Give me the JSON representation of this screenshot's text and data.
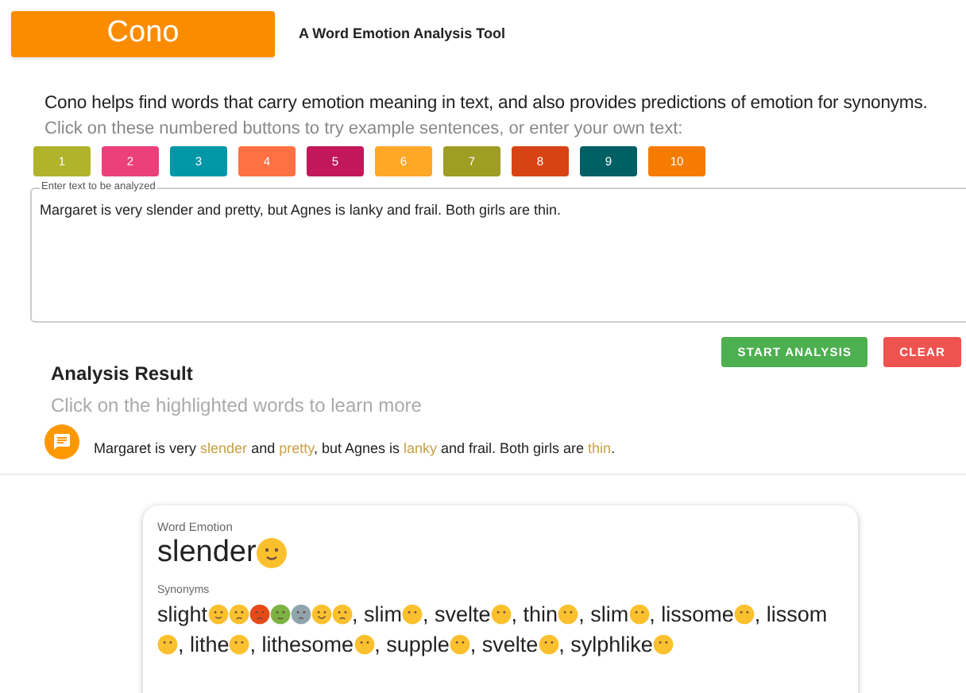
{
  "logo": "Cono",
  "tagline": "A Word Emotion Analysis Tool",
  "intro": "Cono helps find words that carry emotion meaning in text, and also provides predictions of emotion for synonyms.",
  "hint": "Click on these numbered buttons to try example sentences, or enter your own text:",
  "examples": [
    {
      "label": "1",
      "color": "#afb42b"
    },
    {
      "label": "2",
      "color": "#ec407a"
    },
    {
      "label": "3",
      "color": "#0097a7"
    },
    {
      "label": "4",
      "color": "#ff7043"
    },
    {
      "label": "5",
      "color": "#c2185b"
    },
    {
      "label": "6",
      "color": "#ffa726"
    },
    {
      "label": "7",
      "color": "#9e9d24"
    },
    {
      "label": "8",
      "color": "#d84315"
    },
    {
      "label": "9",
      "color": "#006064"
    },
    {
      "label": "10",
      "color": "#f57c00"
    }
  ],
  "input": {
    "label": "Enter text to be analyzed",
    "value": "Margaret is very slender and pretty, but Agnes is lanky and frail. Both girls are thin."
  },
  "buttons": [
    {
      "label": "START ANALYSIS",
      "kind": "primary"
    },
    {
      "label": "CLEAR",
      "kind": "danger"
    }
  ],
  "result": {
    "title": "Analysis Result",
    "subtitle": "Click on the highlighted words to learn more",
    "segments": [
      {
        "text": "Margaret is very ",
        "highlighted": false
      },
      {
        "text": "slender",
        "highlighted": true
      },
      {
        "text": " and ",
        "highlighted": false
      },
      {
        "text": "pretty",
        "highlighted": true
      },
      {
        "text": ", but Agnes is ",
        "highlighted": false
      },
      {
        "text": "lanky",
        "highlighted": true
      },
      {
        "text": " and frail. Both girls are ",
        "highlighted": false
      },
      {
        "text": "thin",
        "highlighted": true
      },
      {
        "text": ".",
        "highlighted": false
      }
    ]
  },
  "card": {
    "label": "Word Emotion",
    "word": "slender",
    "emojis": [
      {
        "kind": "smile"
      }
    ],
    "synonyms_label": "Synonyms",
    "synonyms": [
      {
        "word": "slight",
        "emojis": [
          {
            "kind": "smile"
          },
          {
            "kind": "pensive"
          },
          {
            "kind": "angry"
          },
          {
            "kind": "sick"
          },
          {
            "kind": "fearful"
          },
          {
            "kind": "happy"
          },
          {
            "kind": "crying"
          }
        ]
      },
      {
        "word": ", slim",
        "emojis": [
          {
            "kind": "neutral"
          }
        ]
      },
      {
        "word": ", svelte",
        "emojis": [
          {
            "kind": "neutral"
          }
        ]
      },
      {
        "word": ", thin",
        "emojis": [
          {
            "kind": "neutral"
          }
        ]
      },
      {
        "word": ", slim",
        "emojis": [
          {
            "kind": "neutral"
          }
        ]
      },
      {
        "word": ", lissome",
        "emojis": [
          {
            "kind": "neutral"
          }
        ]
      },
      {
        "word": ", lissom",
        "emojis": [
          {
            "kind": "neutral"
          }
        ]
      },
      {
        "word": ", lithe",
        "emojis": [
          {
            "kind": "neutral"
          }
        ]
      },
      {
        "word": ", lithesome",
        "emojis": [
          {
            "kind": "neutral"
          }
        ]
      },
      {
        "word": ", supple",
        "emojis": [
          {
            "kind": "neutral"
          }
        ]
      },
      {
        "word": ", svelte",
        "emojis": [
          {
            "kind": "neutral"
          }
        ]
      },
      {
        "word": ", sylphlike",
        "emojis": [
          {
            "kind": "neutral"
          }
        ]
      }
    ]
  }
}
